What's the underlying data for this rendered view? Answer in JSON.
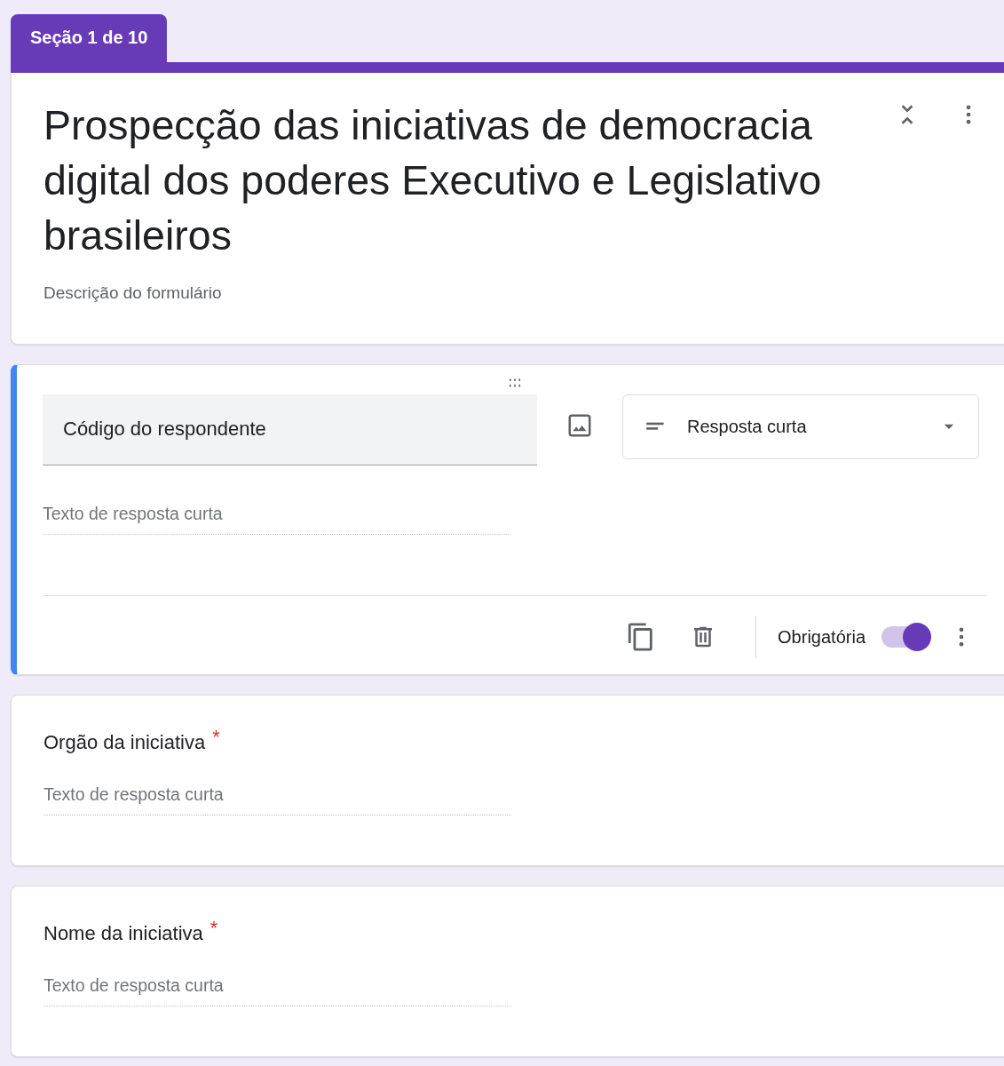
{
  "section_tab": "Seção 1 de 10",
  "form": {
    "title": "Prospecção das iniciativas de democracia digital dos poderes Executivo e Legislativo brasileiros",
    "description": "Descrição do formulário"
  },
  "questions": [
    {
      "kind": "editing",
      "title": "Código do respondente",
      "type_select": "Resposta curta",
      "answer_hint": "Texto de resposta curta",
      "required_label": "Obrigatória",
      "required": true
    },
    {
      "kind": "short",
      "title": "Orgão da iniciativa",
      "required_mark": "*",
      "answer_hint": "Texto de resposta curta"
    },
    {
      "kind": "short",
      "title": "Nome da iniciativa",
      "required_mark": "*",
      "answer_hint": "Texto de resposta curta"
    }
  ]
}
